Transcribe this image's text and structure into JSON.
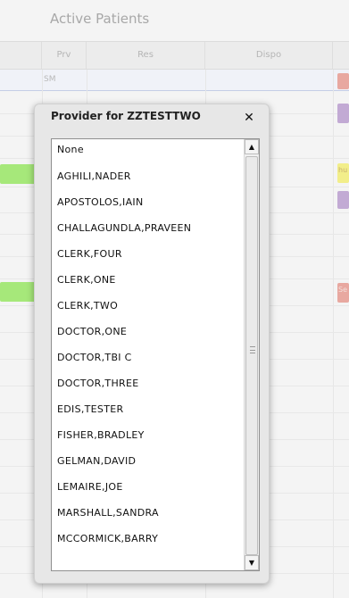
{
  "app": {
    "title": "Active Patients"
  },
  "grid": {
    "columns": [
      "Prv",
      "Res",
      "Dispo"
    ],
    "first_row_provider": "SM",
    "chip_text": [
      "hu",
      "Se"
    ]
  },
  "popup": {
    "title": "Provider for ZZTESTTWO",
    "close_symbol": "✕",
    "options": [
      "None",
      "AGHILI,NADER",
      "APOSTOLOS,IAIN",
      "CHALLAGUNDLA,PRAVEEN",
      "CLERK,FOUR",
      "CLERK,ONE",
      "CLERK,TWO",
      "DOCTOR,ONE",
      "DOCTOR,TBI C",
      "DOCTOR,THREE",
      "EDIS,TESTER",
      "FISHER,BRADLEY",
      "GELMAN,DAVID",
      "LEMAIRE,JOE",
      "MARSHALL,SANDRA",
      "MCCORMICK,BARRY"
    ],
    "scroll_up": "▲",
    "scroll_down": "▼"
  },
  "colors": {
    "green_chip": "#a6e87a",
    "salmon_chip": "#e8a8a0",
    "purple_chip": "#c2aad4",
    "yellow_chip": "#f2ee8a"
  }
}
